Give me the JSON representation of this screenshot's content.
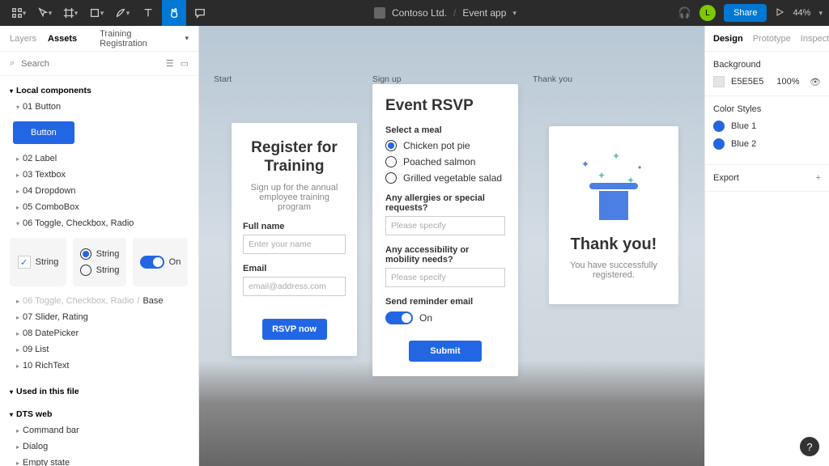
{
  "topbar": {
    "org": "Contoso Ltd.",
    "file": "Event app",
    "share": "Share",
    "zoom": "44%",
    "avatar": "L"
  },
  "leftTabs": {
    "layers": "Layers",
    "assets": "Assets",
    "frame": "Training Registration"
  },
  "search": {
    "placeholder": "Search"
  },
  "sections": {
    "local": "Local components",
    "usedInFile": "Used in this file",
    "dtsWeb": "DTS web"
  },
  "components": {
    "c01": "01 Button",
    "c02": "02 Label",
    "c03": "03 Textbox",
    "c04": "04 Dropdown",
    "c05": "05 ComboBox",
    "c06": "06 Toggle, Checkbox, Radio",
    "c06path": "06 Toggle, Checkbox, Radio",
    "base": "Base",
    "c07": "07 Slider, Rating",
    "c08": "08 DatePicker",
    "c09": "09 List",
    "c10": "10 RichText",
    "d1": "Command bar",
    "d2": "Dialog",
    "d3": "Empty state"
  },
  "demo": {
    "button": "Button",
    "string": "String",
    "on": "On"
  },
  "canvas": {
    "start": {
      "label": "Start",
      "title": "Register for Training",
      "sub": "Sign up for the annual employee training program",
      "fullName": "Full name",
      "fullNamePh": "Enter your name",
      "email": "Email",
      "emailPh": "email@address.com",
      "cta": "RSVP now"
    },
    "signup": {
      "label": "Sign up",
      "title": "Event RSVP",
      "meal": "Select a meal",
      "m1": "Chicken pot pie",
      "m2": "Poached salmon",
      "m3": "Grilled vegetable salad",
      "allergies": "Any allergies or special requests?",
      "allergiesPh": "Please specify",
      "access": "Any accessibility or mobility needs?",
      "accessPh": "Please specify",
      "reminder": "Send reminder email",
      "on": "On",
      "submit": "Submit"
    },
    "thanks": {
      "label": "Thank you",
      "title": "Thank you!",
      "sub": "You have successfully registered."
    }
  },
  "right": {
    "tabs": {
      "design": "Design",
      "prototype": "Prototype",
      "inspect": "Inspect"
    },
    "bg": {
      "title": "Background",
      "hex": "E5E5E5",
      "pct": "100%"
    },
    "colorStyles": {
      "title": "Color Styles",
      "b1": "Blue 1",
      "b2": "Blue 2"
    },
    "export": "Export"
  }
}
